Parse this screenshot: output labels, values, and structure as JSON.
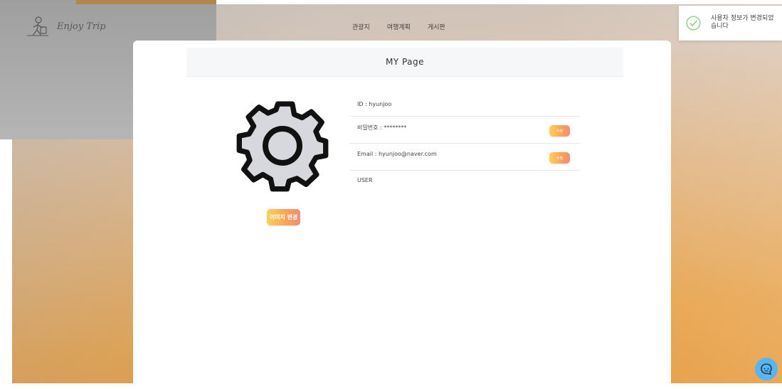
{
  "header": {
    "logo_text": "Enjoy Trip",
    "nav": [
      "관광지",
      "여행계획",
      "게시판"
    ]
  },
  "card": {
    "title": "MY Page",
    "change_image_label": "이미지 변경",
    "rows": [
      {
        "text": "ID : hyunjoo"
      },
      {
        "text": "비밀번호 : ********",
        "button": "수정"
      },
      {
        "text": "Email : hyunjoo@naver.com",
        "button": "수정"
      },
      {
        "text": "USER"
      }
    ]
  },
  "toast": {
    "message": "사용자 정보가 변경되었습니다",
    "icon": "check-circle-icon",
    "icon_color": "#8ed08e"
  },
  "chat": {
    "icon": "chat-icon",
    "color": "#5bb4f0"
  },
  "colors": {
    "button_gradient_start": "#ffcf5c",
    "button_gradient_end": "#f18d77"
  }
}
